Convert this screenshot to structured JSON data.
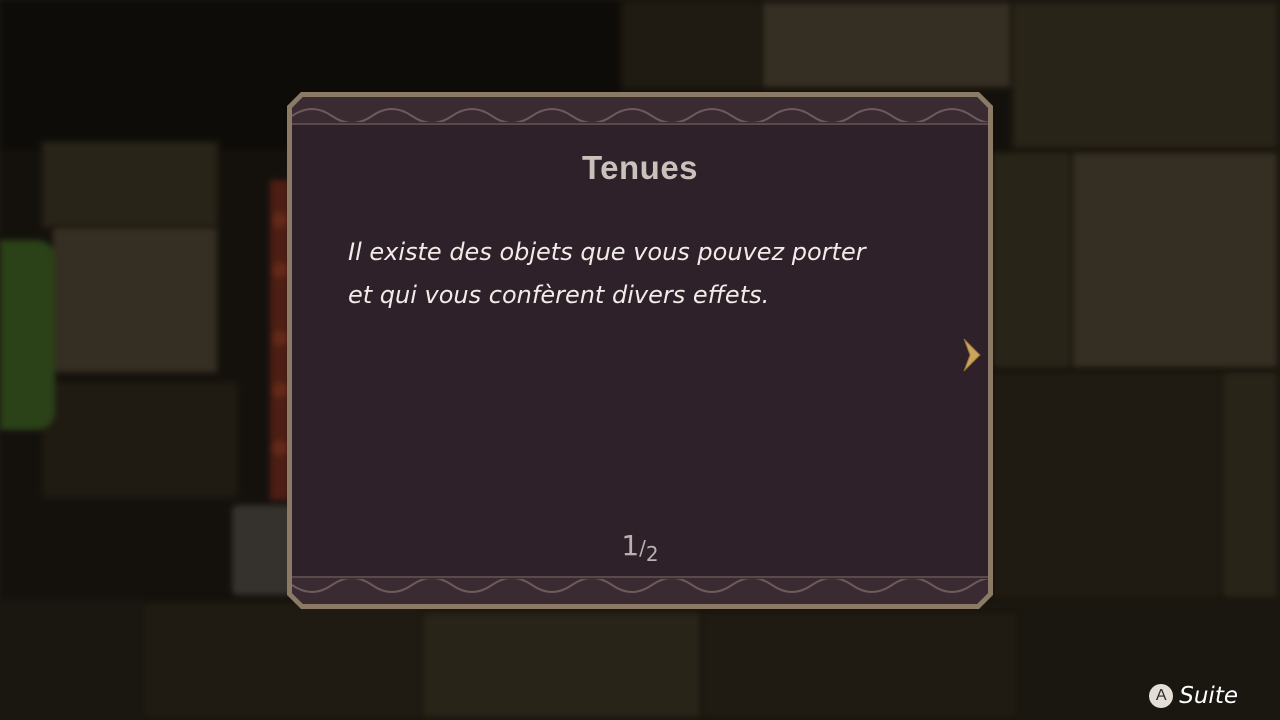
{
  "tutorial": {
    "title": "Tenues",
    "lines": [
      "Il existe des objets que vous pouvez porter",
      "et qui vous confèrent divers effets."
    ],
    "page_current": "1",
    "page_separator": "/",
    "page_total": "2"
  },
  "prompt": {
    "button_glyph": "A",
    "label": "Suite"
  },
  "icons": {
    "next": "chevron-right-icon",
    "button": "a-button-icon"
  },
  "colors": {
    "panel_fill": "#2f2129",
    "panel_frame": "#8a7a66",
    "arrow": "#c9a65a",
    "title": "#c9c2bc",
    "body_text": "#f2ece8"
  }
}
